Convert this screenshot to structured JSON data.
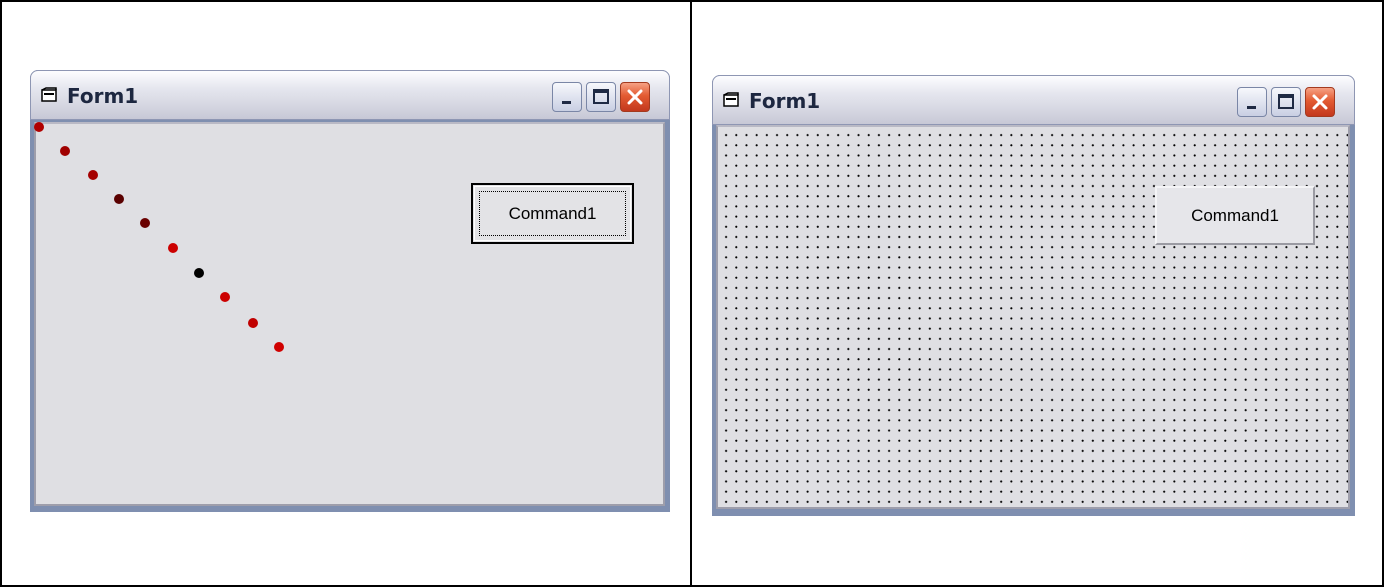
{
  "left_window": {
    "title": "Form1",
    "command_button": "Command1",
    "dots": [
      {
        "color": "#b00000"
      },
      {
        "color": "#a00000"
      },
      {
        "color": "#a50000"
      },
      {
        "color": "#5a0000"
      },
      {
        "color": "#6a0000"
      },
      {
        "color": "#cc0000"
      },
      {
        "color": "#000000"
      },
      {
        "color": "#cc0000"
      },
      {
        "color": "#c00000"
      },
      {
        "color": "#d00000"
      }
    ]
  },
  "right_window": {
    "title": "Form1",
    "command_button": "Command1"
  }
}
